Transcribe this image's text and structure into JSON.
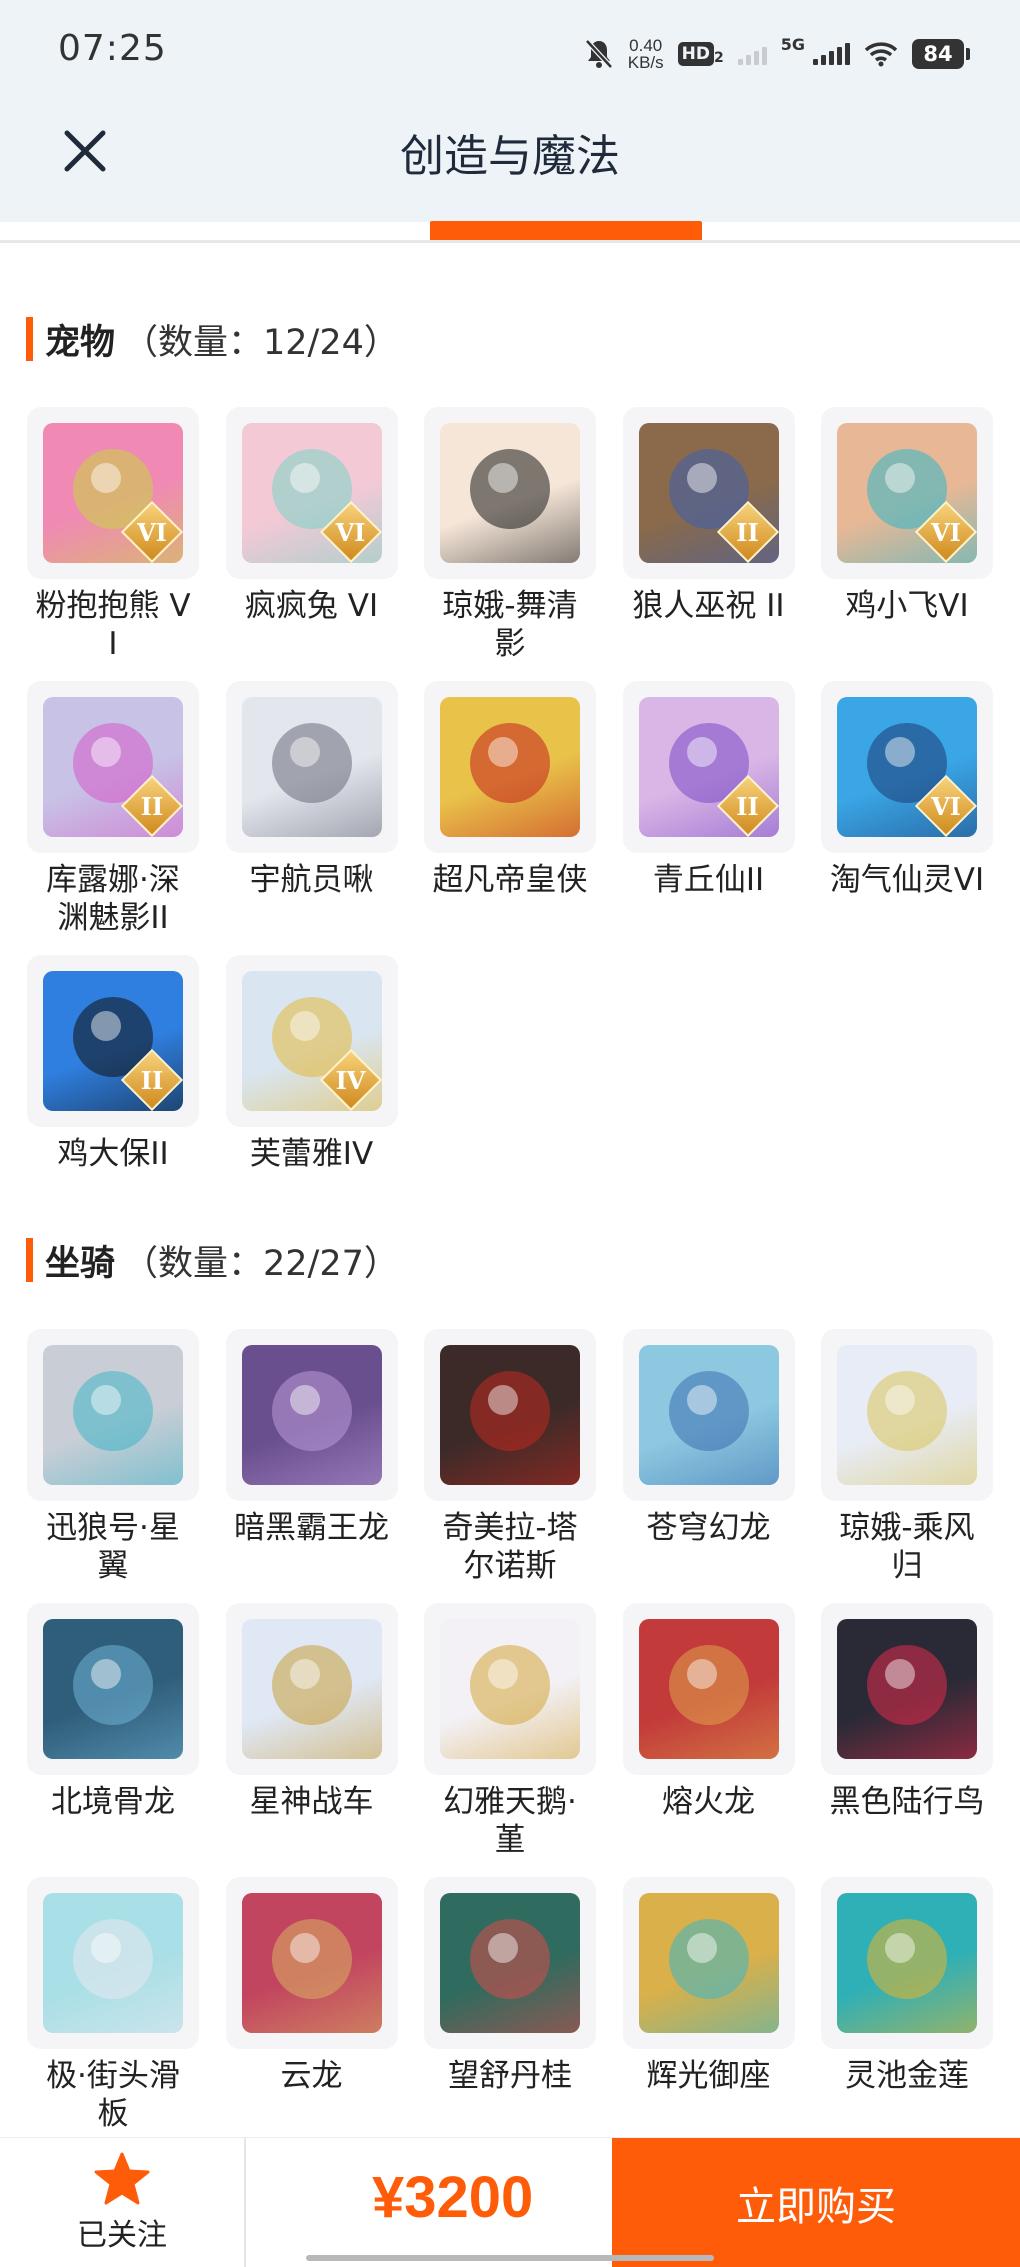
{
  "status_bar": {
    "time": "07:25",
    "net_speed_value": "0.40",
    "net_speed_unit": "KB/s",
    "hd_badge": "HD",
    "hd_sub": "2",
    "network": "5G",
    "battery": "84"
  },
  "header": {
    "title": "创造与魔法"
  },
  "pets": {
    "title": "宠物",
    "count": "（数量：12/24）",
    "items": [
      {
        "name": "粉抱抱熊 VI",
        "tier": "VI",
        "color": "#f08ab4",
        "accent": "#c9d640"
      },
      {
        "name": "疯疯兔 VI",
        "tier": "VI",
        "color": "#f4c9d6",
        "accent": "#7ad3c6"
      },
      {
        "name": "琼娥-舞清影",
        "tier": "",
        "color": "#f6e6d8",
        "accent": "#1c1c1c"
      },
      {
        "name": "狼人巫祝 II",
        "tier": "II",
        "color": "#8a6a4a",
        "accent": "#3d5fb0"
      },
      {
        "name": "鸡小飞VI",
        "tier": "VI",
        "color": "#e8b896",
        "accent": "#2fb7c9"
      },
      {
        "name": "库露娜·深渊魅影II",
        "tier": "II",
        "color": "#c7c2e6",
        "accent": "#d65ac8"
      },
      {
        "name": "宇航员啾",
        "tier": "",
        "color": "#e4e6ee",
        "accent": "#6a6d7a"
      },
      {
        "name": "超凡帝皇侠",
        "tier": "",
        "color": "#e9c24a",
        "accent": "#c3231e"
      },
      {
        "name": "青丘仙II",
        "tier": "II",
        "color": "#d8b7e6",
        "accent": "#7a49c6"
      },
      {
        "name": "淘气仙灵VI",
        "tier": "VI",
        "color": "#3aa6e6",
        "accent": "#1d3b73"
      },
      {
        "name": "鸡大保II",
        "tier": "II",
        "color": "#2f7fe0",
        "accent": "#111111"
      },
      {
        "name": "芙蕾雅IV",
        "tier": "IV",
        "color": "#d9e6f2",
        "accent": "#e4b83a"
      }
    ]
  },
  "mounts": {
    "title": "坐骑",
    "count": "（数量：22/27）",
    "items": [
      {
        "name": "迅狼号·星翼",
        "tier": "",
        "color": "#c9ced6",
        "accent": "#3fb4c6"
      },
      {
        "name": "暗黑霸王龙",
        "tier": "",
        "color": "#6a4f8f",
        "accent": "#b99ad8"
      },
      {
        "name": "奇美拉-塔尔诺斯",
        "tier": "",
        "color": "#3c2a28",
        "accent": "#c0281f"
      },
      {
        "name": "苍穹幻龙",
        "tier": "",
        "color": "#8cc8e0",
        "accent": "#3a6fb0"
      },
      {
        "name": "琼娥-乘风归",
        "tier": "",
        "color": "#e8ecf6",
        "accent": "#d8c45a"
      },
      {
        "name": "北境骨龙",
        "tier": "",
        "color": "#2f5e7a",
        "accent": "#6fb3d6"
      },
      {
        "name": "星神战车",
        "tier": "",
        "color": "#e0e8f6",
        "accent": "#c79e3a"
      },
      {
        "name": "幻雅天鹅·堇",
        "tier": "",
        "color": "#f3f1f6",
        "accent": "#d3a53a"
      },
      {
        "name": "熔火龙",
        "tier": "",
        "color": "#c23a3a",
        "accent": "#e0a24a"
      },
      {
        "name": "黑色陆行鸟",
        "tier": "",
        "color": "#2a2a36",
        "accent": "#e02a4a"
      },
      {
        "name": "极·街头滑板",
        "tier": "",
        "color": "#a9dfe6",
        "accent": "#e8e8f0"
      },
      {
        "name": "云龙",
        "tier": "",
        "color": "#c2455f",
        "accent": "#d8b062"
      },
      {
        "name": "望舒丹桂",
        "tier": "",
        "color": "#2f6b5e",
        "accent": "#d84a4a"
      },
      {
        "name": "辉光御座",
        "tier": "",
        "color": "#d9b04a",
        "accent": "#3bb7c8"
      },
      {
        "name": "灵池金莲",
        "tier": "",
        "color": "#2fb0b6",
        "accent": "#e8b42a"
      }
    ]
  },
  "bottom_bar": {
    "follow_label": "已关注",
    "price": "¥3200",
    "buy_label": "立即购买"
  },
  "colors": {
    "accent": "#ff5c0a",
    "header_bg": "#eef3f8"
  }
}
